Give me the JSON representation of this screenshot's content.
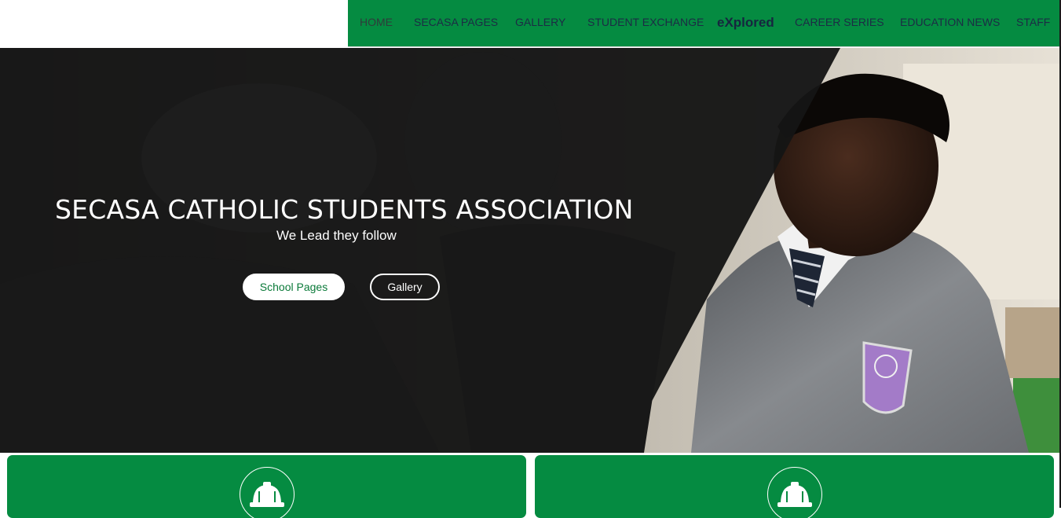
{
  "nav": {
    "items": [
      {
        "label": "HOME"
      },
      {
        "label": "SECASA PAGES"
      },
      {
        "label": "GALLERY"
      },
      {
        "label": "STUDENT EXCHANGE"
      },
      {
        "label": "eXplored"
      },
      {
        "label": "CAREER SERIES"
      },
      {
        "label": "EDUCATION NEWS"
      },
      {
        "label": "STAFF"
      }
    ]
  },
  "hero": {
    "title": "SECASA CATHOLIC STUDENTS ASSOCIATION",
    "subtitle": "We Lead they follow",
    "buttons": {
      "school_pages": "School Pages",
      "gallery": "Gallery"
    }
  },
  "cards": [
    {
      "icon": "hard-hat-icon"
    },
    {
      "icon": "hard-hat-icon"
    }
  ],
  "colors": {
    "brand_green": "#058b41",
    "nav_text": "#1c2b45",
    "hero_overlay": "#141414"
  }
}
